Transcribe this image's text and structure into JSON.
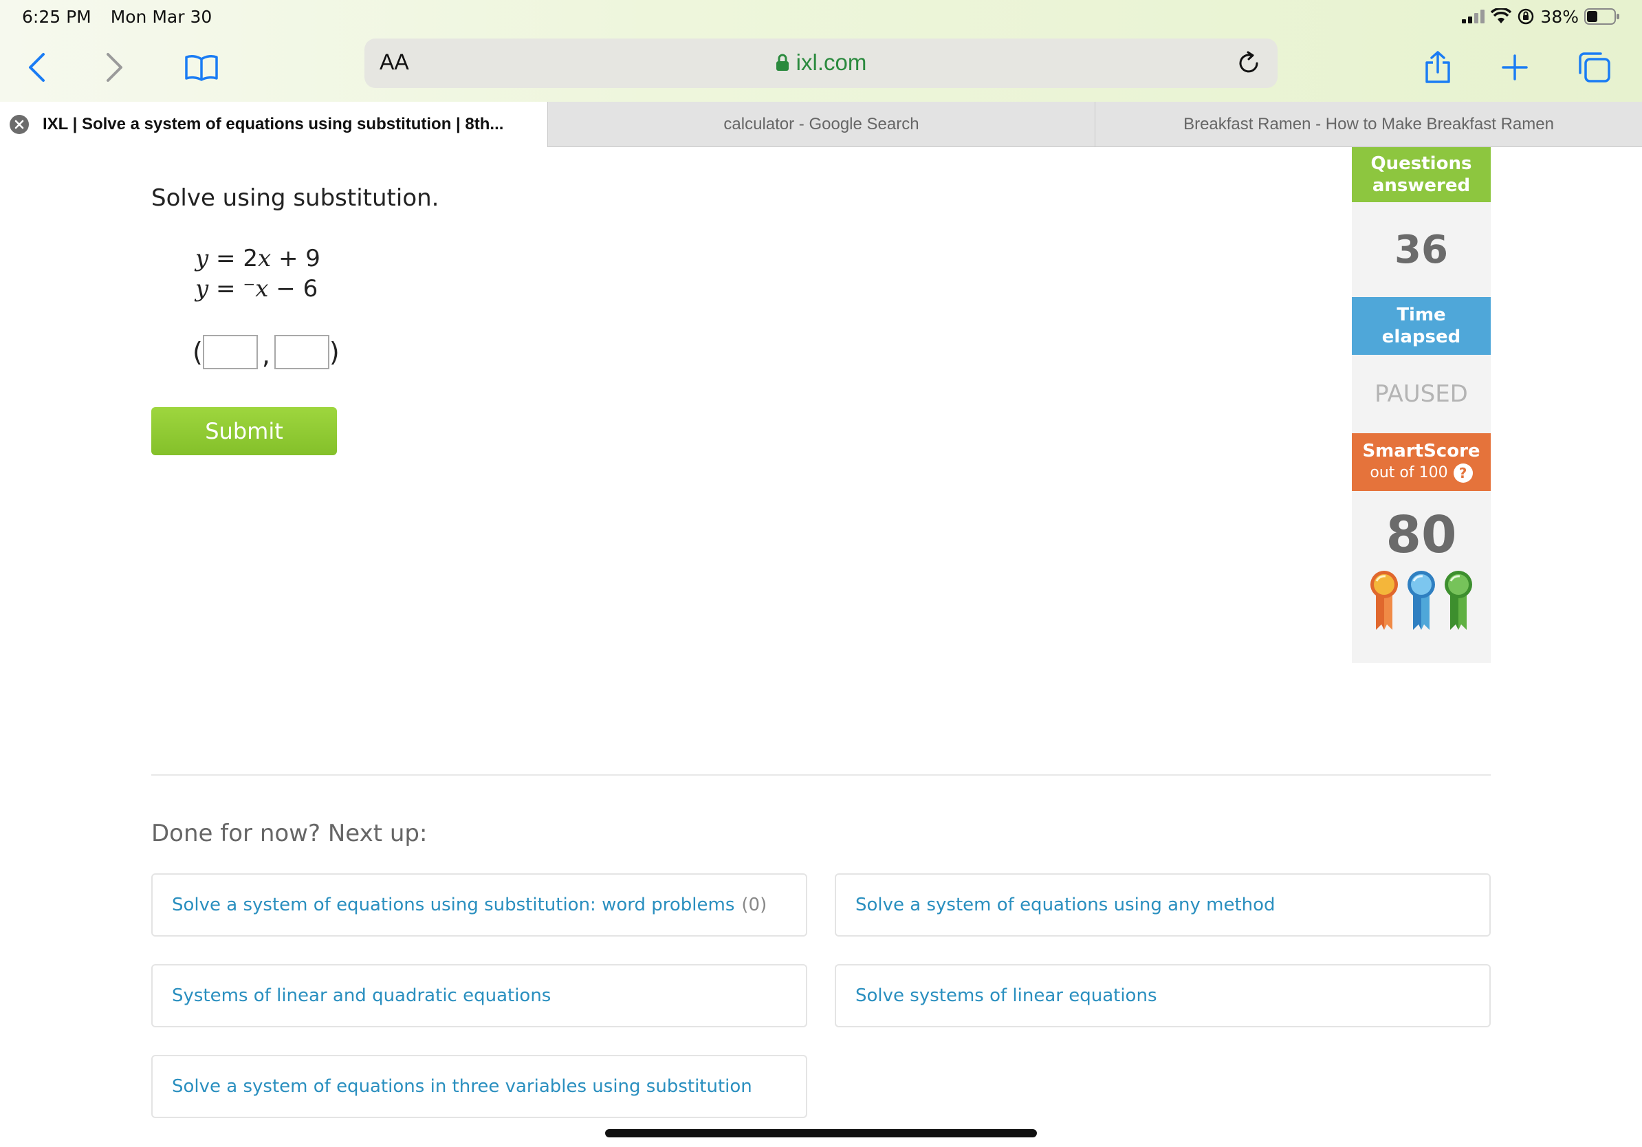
{
  "status": {
    "time": "6:25 PM",
    "date": "Mon Mar 30",
    "battery": "38%"
  },
  "toolbar": {
    "text_size": "AA",
    "url": "ixl.com"
  },
  "tabs": [
    {
      "label": "IXL | Solve a system of equations using substitution | 8th..."
    },
    {
      "label": "calculator - Google Search"
    },
    {
      "label": "Breakfast Ramen - How to Make Breakfast Ramen"
    }
  ],
  "question": {
    "prompt": "Solve using substitution.",
    "eq1": {
      "lhs": "y",
      "mid": " = 2",
      "var": "x",
      "rhs": " + 9"
    },
    "eq2": {
      "lhs": "y",
      "mid": " = ⁻",
      "var": "x",
      "rhs": " − 6"
    },
    "open_paren": "(",
    "comma": ",",
    "close_paren": ")",
    "x_value": "",
    "y_value": "",
    "submit_label": "Submit"
  },
  "sidebar": {
    "questions_answered_label_1": "Questions",
    "questions_answered_label_2": "answered",
    "questions_answered": "36",
    "time_elapsed_label_1": "Time",
    "time_elapsed_label_2": "elapsed",
    "time_elapsed": "PAUSED",
    "smartscore_label": "SmartScore",
    "smartscore_sub": "out of 100",
    "help": "?",
    "smartscore": "80"
  },
  "next_up": {
    "title": "Done for now? Next up:",
    "items": [
      {
        "label": "Solve a system of equations using substitution: word problems",
        "count": "(0)"
      },
      {
        "label": "Solve a system of equations using any method"
      },
      {
        "label": "Systems of linear and quadratic equations"
      },
      {
        "label": "Solve systems of linear equations"
      },
      {
        "label": "Solve a system of equations in three variables using substitution"
      }
    ]
  },
  "colors": {
    "green": "#8dc63f",
    "blue": "#4fa7d9",
    "orange": "#e5733b",
    "link": "#2a8fbf"
  }
}
